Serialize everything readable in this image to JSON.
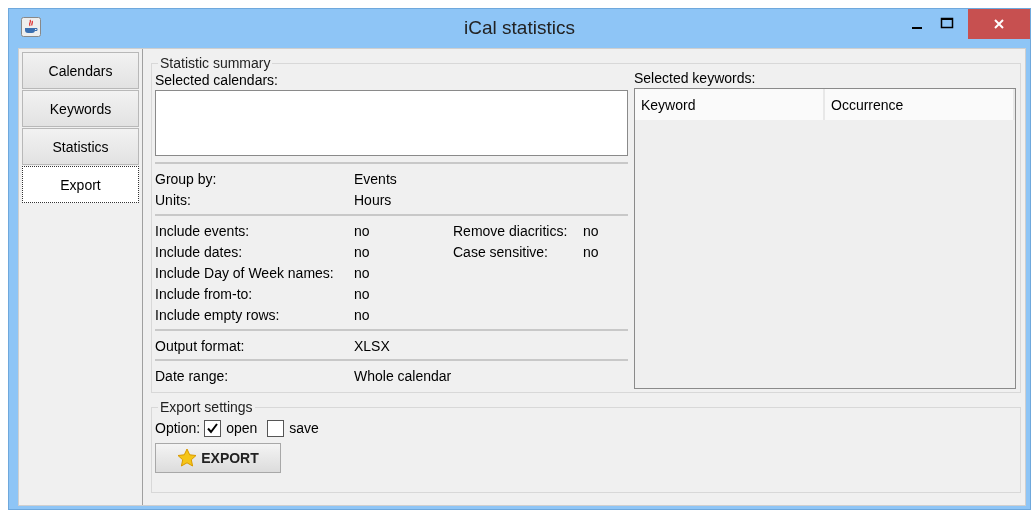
{
  "window": {
    "title": "iCal statistics"
  },
  "tabs": [
    {
      "label": "Calendars",
      "selected": false
    },
    {
      "label": "Keywords",
      "selected": false
    },
    {
      "label": "Statistics",
      "selected": false
    },
    {
      "label": "Export",
      "selected": true
    }
  ],
  "summary": {
    "title": "Statistic summary",
    "calendars_label": "Selected calendars:",
    "sections": [
      {
        "rows": [
          {
            "label": "Group by:",
            "value": "Events"
          },
          {
            "label": "Units:",
            "value": "Hours"
          }
        ]
      },
      {
        "rows": [
          {
            "label": "Include events:",
            "value": "no"
          },
          {
            "label": "Include dates:",
            "value": "no"
          },
          {
            "label": "Include Day of Week names:",
            "value": "no"
          },
          {
            "label": "Include from-to:",
            "value": "no"
          },
          {
            "label": "Include empty rows:",
            "value": "no"
          }
        ],
        "side_rows": [
          {
            "label": "Remove diacritics:",
            "value": "no"
          },
          {
            "label": "Case sensitive:",
            "value": "no"
          }
        ]
      },
      {
        "rows": [
          {
            "label": "Output format:",
            "value": "XLSX"
          }
        ]
      },
      {
        "rows": [
          {
            "label": "Date range:",
            "value": "Whole calendar"
          }
        ]
      }
    ],
    "keywords_label": "Selected keywords:",
    "keyword_columns": [
      "Keyword",
      "Occurrence"
    ]
  },
  "export": {
    "title": "Export settings",
    "option_label": "Option:",
    "options": [
      {
        "label": "open",
        "checked": true
      },
      {
        "label": "save",
        "checked": false
      }
    ],
    "button": "EXPORT"
  }
}
